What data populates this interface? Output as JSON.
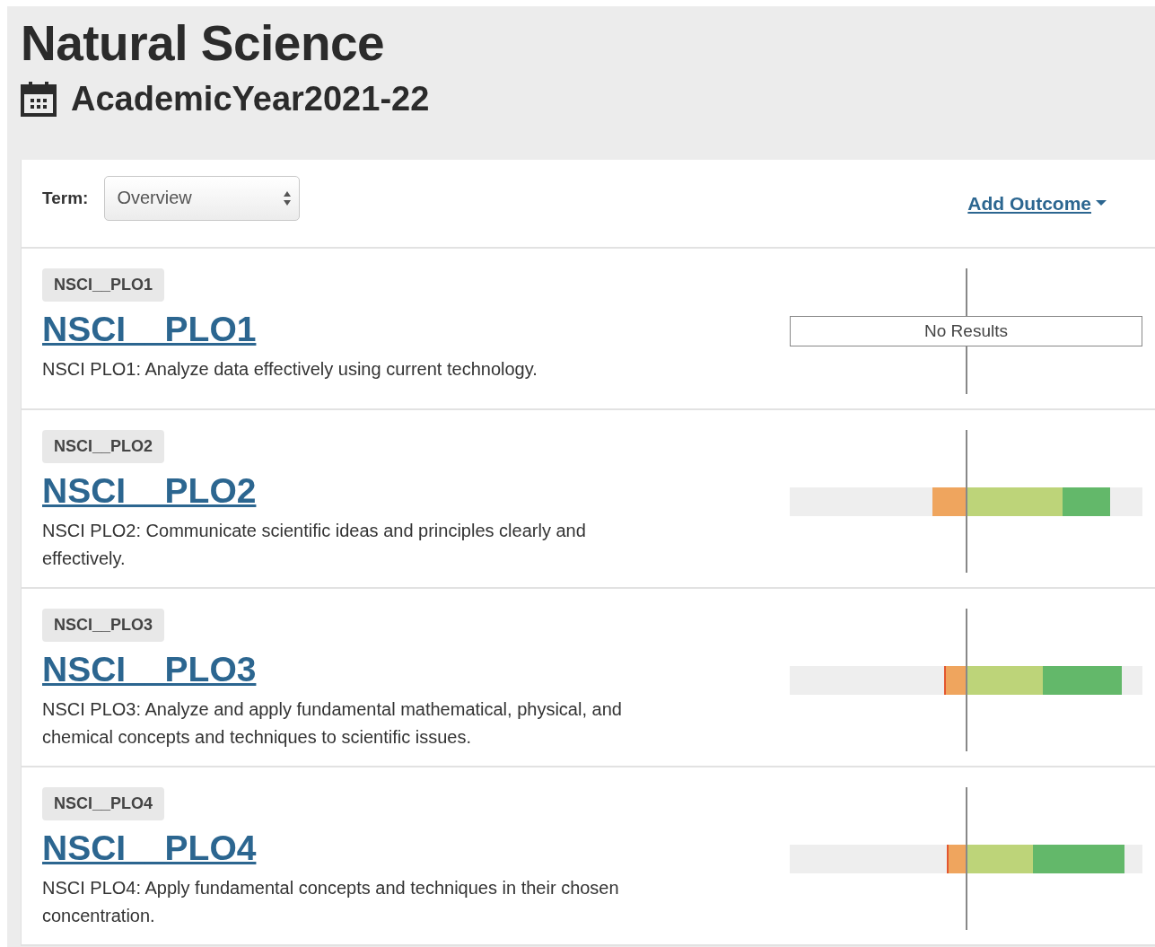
{
  "header": {
    "title": "Natural Science",
    "year": "AcademicYear2021-22"
  },
  "toolbar": {
    "term_label": "Term:",
    "term_select": {
      "value": "Overview"
    },
    "add_outcome": "Add Outcome"
  },
  "outcomes": [
    {
      "tag": "NSCI__PLO1",
      "title": "NSCI__PLO1",
      "description": "NSCI PLO1: Analyze data effectively using current technology.",
      "result": {
        "kind": "empty",
        "text": "No Results"
      }
    },
    {
      "tag": "NSCI__PLO2",
      "title": "NSCI__PLO2",
      "description": "NSCI PLO2: Communicate scientific ideas and principles clearly and effectively.",
      "result": {
        "kind": "bar"
      }
    },
    {
      "tag": "NSCI__PLO3",
      "title": "NSCI__PLO3",
      "description": "NSCI PLO3: Analyze and apply fundamental mathematical, physical, and chemical concepts and techniques to scientific issues.",
      "result": {
        "kind": "bar"
      }
    },
    {
      "tag": "NSCI__PLO4",
      "title": "NSCI__PLO4",
      "description": "NSCI PLO4: Apply fundamental concepts and techniques in their chosen concentration.",
      "result": {
        "kind": "bar"
      }
    }
  ]
}
